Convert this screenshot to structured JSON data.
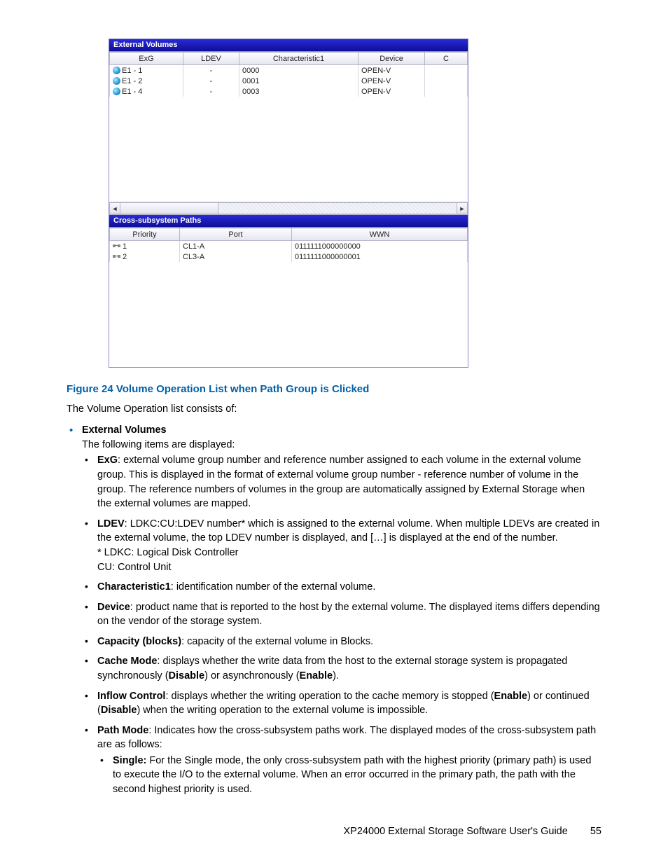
{
  "screenshot": {
    "externalVolumes": {
      "title": "External Volumes",
      "headers": {
        "exg": "ExG",
        "ldev": "LDEV",
        "char1": "Characteristic1",
        "device": "Device",
        "c": "C"
      },
      "rows": [
        {
          "exg": "E1 - 1",
          "ldev": "-",
          "char1": "0000",
          "device": "OPEN-V",
          "c": ""
        },
        {
          "exg": "E1 - 2",
          "ldev": "-",
          "char1": "0001",
          "device": "OPEN-V",
          "c": ""
        },
        {
          "exg": "E1 - 4",
          "ldev": "-",
          "char1": "0003",
          "device": "OPEN-V",
          "c": ""
        }
      ]
    },
    "crossPaths": {
      "title": "Cross-subsystem Paths",
      "headers": {
        "priority": "Priority",
        "port": "Port",
        "wwn": "WWN"
      },
      "rows": [
        {
          "priority": "1",
          "port": "CL1-A",
          "wwn": "0111111000000000"
        },
        {
          "priority": "2",
          "port": "CL3-A",
          "wwn": "0111111000000001"
        }
      ]
    }
  },
  "figure": {
    "caption": "Figure 24 Volume Operation List when Path Group is Clicked"
  },
  "intro": "The Volume Operation list consists of:",
  "item1": {
    "title": "External Volumes",
    "sub": "The following items are displayed:",
    "exg": {
      "t": "ExG",
      "d": ": external volume group number and reference number assigned to each volume in the external volume group. This is displayed in the format of external volume group number - reference number of volume in the group. The reference numbers of volumes in the group are automatically assigned by External Storage when the external volumes are mapped."
    },
    "ldev": {
      "t": "LDEV",
      "d": ": LDKC:CU:LDEV number* which is assigned to the external volume. When multiple LDEVs are created in the external volume, the top LDEV number is displayed, and […] is displayed at the end of the number.",
      "n1": "* LDKC: Logical Disk Controller",
      "n2": "CU: Control Unit"
    },
    "char1": {
      "t": "Characteristic1",
      "d": ": identification number of the external volume."
    },
    "device": {
      "t": "Device",
      "d": ": product name that is reported to the host by the external volume. The displayed items differs depending on the vendor of the storage system."
    },
    "capacity": {
      "t": "Capacity (blocks)",
      "d": ": capacity of the external volume in Blocks."
    },
    "cache": {
      "t": "Cache Mode",
      "d1": ": displays whether the write data from the host to the external storage system is propagated synchronously (",
      "disable": "Disable",
      "d2": ") or asynchronously (",
      "enable": "Enable",
      "d3": ")."
    },
    "inflow": {
      "t": "Inflow Control",
      "d1": ": displays whether the writing operation to the cache memory is stopped (",
      "enable": "Enable",
      "d2": ") or continued (",
      "disable": "Disable",
      "d3": ") when the writing operation to the external volume is impossible."
    },
    "pathmode": {
      "t": "Path Mode",
      "d": ": Indicates how the cross-subsystem paths work. The displayed modes of the cross-subsystem path are as follows:",
      "single": {
        "t": "Single:",
        "d": " For the Single mode, the only cross-subsystem path with the highest priority (primary path) is used to execute the I/O to the external volume. When an error occurred in the primary path, the path with the second highest priority is used."
      }
    }
  },
  "footer": {
    "title": "XP24000 External Storage Software User's Guide",
    "page": "55"
  }
}
